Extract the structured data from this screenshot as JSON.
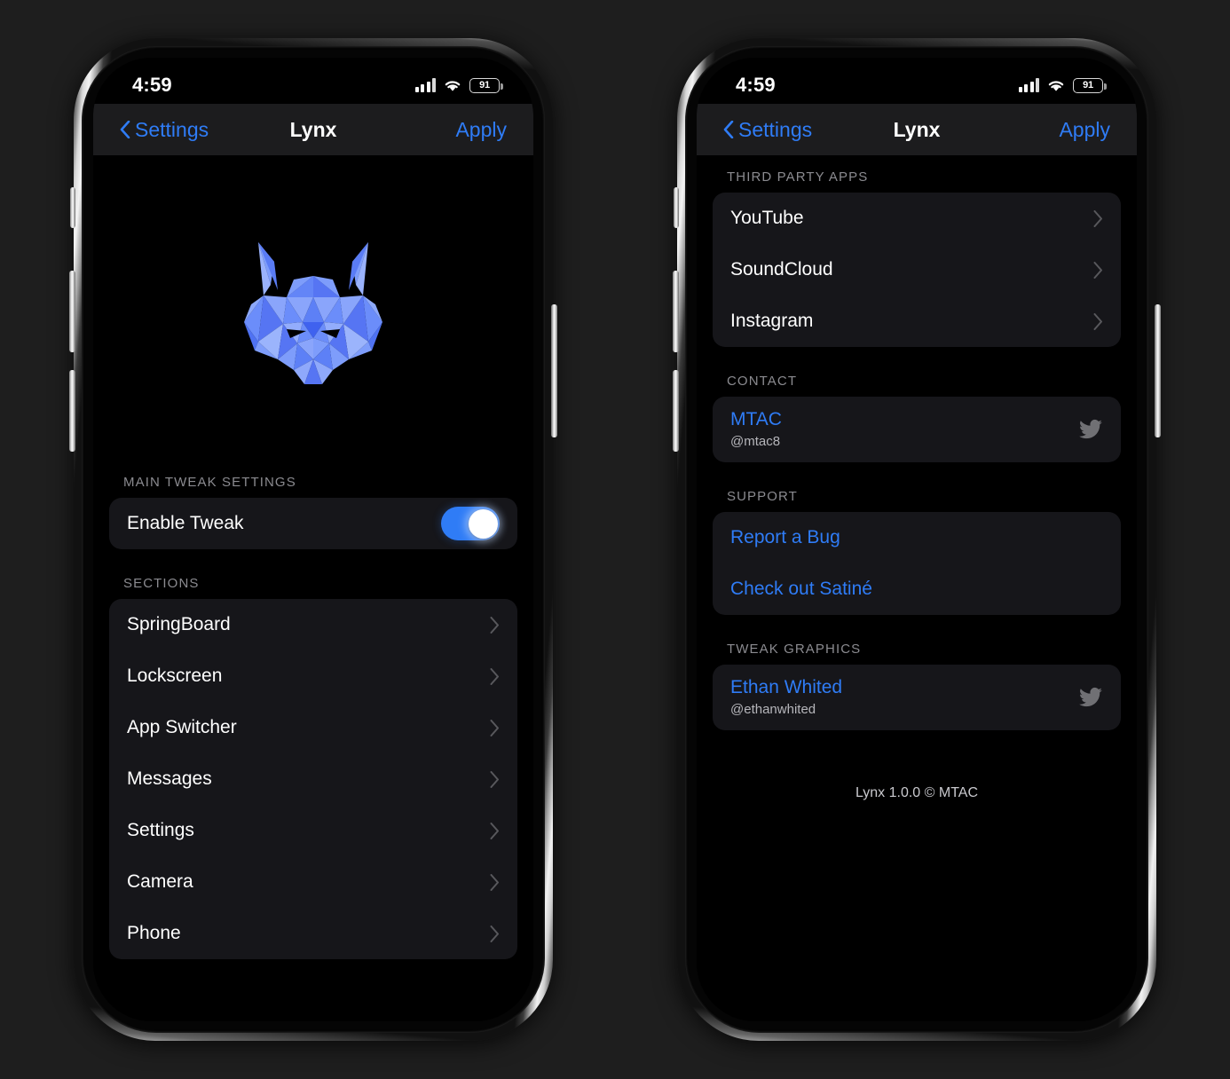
{
  "statusbar": {
    "time": "4:59",
    "battery_level": "91",
    "signal_icon": "cellular-signal-icon",
    "wifi_icon": "wifi-icon",
    "battery_icon": "battery-icon"
  },
  "navbar": {
    "back_label": "Settings",
    "title": "Lynx",
    "action_label": "Apply",
    "back_icon": "chevron-left-icon"
  },
  "colors": {
    "accent": "#2f7cf6",
    "card": "#16161a",
    "screen_bg": "#000000",
    "navbar_bg": "#1c1c1e",
    "page_bg": "#1e1e1e",
    "header_text": "#8b8b90"
  },
  "screen_one": {
    "logo_icon": "lynx-logo-icon",
    "sections": [
      {
        "header": "MAIN TWEAK SETTINGS",
        "rows": [
          {
            "label": "Enable Tweak",
            "type": "toggle",
            "value": "on"
          }
        ]
      },
      {
        "header": "SECTIONS",
        "rows": [
          {
            "label": "SpringBoard",
            "type": "disclosure"
          },
          {
            "label": "Lockscreen",
            "type": "disclosure"
          },
          {
            "label": "App Switcher",
            "type": "disclosure"
          },
          {
            "label": "Messages",
            "type": "disclosure"
          },
          {
            "label": "Settings",
            "type": "disclosure"
          },
          {
            "label": "Camera",
            "type": "disclosure"
          },
          {
            "label": "Phone",
            "type": "disclosure"
          }
        ]
      }
    ]
  },
  "screen_two": {
    "sections": [
      {
        "header": "THIRD PARTY APPS",
        "rows": [
          {
            "label": "YouTube",
            "type": "disclosure"
          },
          {
            "label": "SoundCloud",
            "type": "disclosure"
          },
          {
            "label": "Instagram",
            "type": "disclosure"
          }
        ]
      },
      {
        "header": "CONTACT",
        "rows": [
          {
            "name": "MTAC",
            "handle": "@mtac8",
            "type": "account",
            "icon": "twitter-bird-icon"
          }
        ]
      },
      {
        "header": "SUPPORT",
        "rows": [
          {
            "label": "Report a Bug",
            "type": "link"
          },
          {
            "label": "Check out Satiné",
            "type": "link"
          }
        ]
      },
      {
        "header": "TWEAK GRAPHICS",
        "rows": [
          {
            "name": "Ethan Whited",
            "handle": "@ethanwhited",
            "type": "account",
            "icon": "twitter-bird-icon"
          }
        ]
      }
    ],
    "footer": "Lynx 1.0.0 © MTAC"
  }
}
